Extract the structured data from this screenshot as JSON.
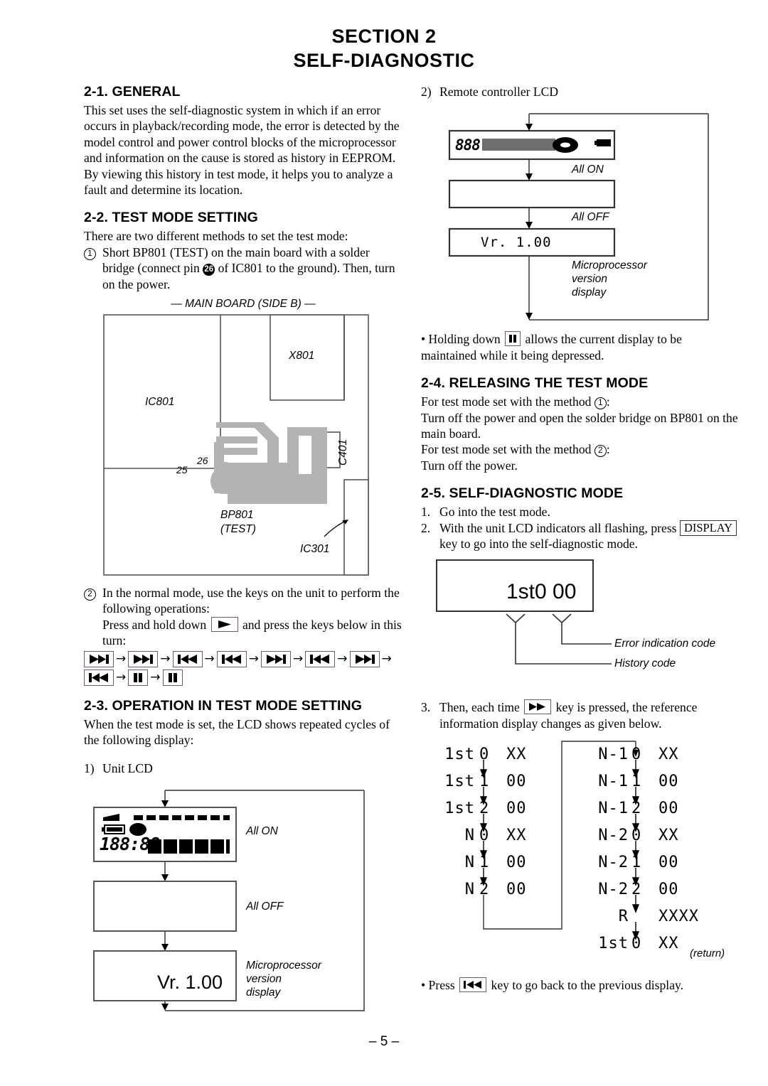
{
  "title": {
    "line1": "SECTION 2",
    "line2": "SELF-DIAGNOSTIC"
  },
  "page_number": "– 5 –",
  "sections": {
    "general": {
      "heading": "2-1. GENERAL",
      "paragraph1": "This set uses the self-diagnostic system in which if an error occurs in playback/recording mode, the error is detected by the model control and power control blocks of the microprocessor and information on the cause is stored as history in EEPROM.",
      "paragraph2": "By viewing this history in test mode, it helps you to analyze a fault and determine its location."
    },
    "test_mode_setting": {
      "heading": "2-2. TEST MODE SETTING",
      "intro": "There are two different methods to set the test mode:",
      "method1_num": "1",
      "method1_a": "Short BP801 (TEST) on the main board with a solder bridge (connect pin",
      "method1_pin": "26",
      "method1_b": "of IC801 to the ground).  Then, turn on the power.",
      "method2_num": "2",
      "method2_a": "In the normal mode, use the keys on the unit to perform the following operations:",
      "method2_b_pre": "Press and hold down",
      "method2_b_post": "and press the keys below in this turn:",
      "key_sequence": [
        "ffwd",
        "ffwd",
        "rew",
        "rew",
        "ffwd",
        "rew",
        "ffwd",
        "rew",
        "pause",
        "pause"
      ]
    },
    "board_figure": {
      "caption": "— MAIN BOARD (SIDE B) —",
      "labels": {
        "ic801": "IC801",
        "x801": "X801",
        "c401": "C401",
        "bp801_line1": "BP801",
        "bp801_line2": "(TEST)",
        "ic301": "IC301",
        "pin25": "25",
        "pin26": "26"
      }
    },
    "operation_in_test_mode": {
      "heading": "2-3. OPERATION IN TEST MODE SETTING",
      "paragraph": "When the test mode is set, the LCD shows repeated cycles of the following display:",
      "sub1_num": "1)",
      "sub1_label": "Unit LCD",
      "sub2_num": "2)",
      "sub2_label": "Remote controller LCD"
    },
    "unit_lcd_flow": {
      "step1_note": "All ON",
      "step2_note": "All OFF",
      "step3_note": "Microprocessor\nversion\ndisplay",
      "step3_value": "Vr. 1.00",
      "segment_digits": "188:88"
    },
    "remote_lcd_flow": {
      "step1_note": "All ON",
      "step2_note": "All OFF",
      "step3_note": "Microprocessor\nversion\ndisplay",
      "step3_value": "Vr. 1.00",
      "segment_digits": "888"
    },
    "hold_note": {
      "pre": "• Holding down",
      "post": "allows the current display to be maintained while it being depressed."
    },
    "releasing_test_mode": {
      "heading": "2-4. RELEASING THE TEST MODE",
      "line1_pre": "For test mode set with the method",
      "line1_num": "1",
      "line1_post": ":",
      "line2": "Turn off the power and open the solder bridge on BP801 on the main board.",
      "line3_pre": "For test mode set with the method",
      "line3_num": "2",
      "line3_post": ":",
      "line4": "Turn off the power."
    },
    "self_diagnostic_mode": {
      "heading": "2-5. SELF-DIAGNOSTIC MODE",
      "step1_num": "1.",
      "step1": "Go into the test mode.",
      "step2_num": "2.",
      "step2_a": "With the unit LCD indicators all flashing, press",
      "step2_key": "DISPLAY",
      "step2_b": "key to go into the self-diagnostic mode.",
      "display_value": "1st0  00",
      "callout_error": "Error indication code",
      "callout_history": "History code",
      "step3_num": "3.",
      "step3_a": "Then, each time",
      "step3_b": "key is pressed, the reference information display changes as given below.",
      "press_back_pre": "• Press",
      "press_back_post": "key to go back to the previous display."
    }
  },
  "code_table": {
    "left_column": [
      {
        "history": "1st",
        "index": "0",
        "error": "XX"
      },
      {
        "history": "1st",
        "index": "1",
        "error": "00"
      },
      {
        "history": "1st",
        "index": "2",
        "error": "00"
      },
      {
        "history": "N",
        "index": "0",
        "error": "XX"
      },
      {
        "history": "N",
        "index": "1",
        "error": "00"
      },
      {
        "history": "N",
        "index": "2",
        "error": "00"
      }
    ],
    "right_column": [
      {
        "history": "N‑1",
        "index": "0",
        "error": "XX"
      },
      {
        "history": "N‑1",
        "index": "1",
        "error": "00"
      },
      {
        "history": "N‑1",
        "index": "2",
        "error": "00"
      },
      {
        "history": "N‑2",
        "index": "0",
        "error": "XX"
      },
      {
        "history": "N‑2",
        "index": "1",
        "error": "00"
      },
      {
        "history": "N‑2",
        "index": "2",
        "error": "00"
      },
      {
        "history": "R",
        "index": "",
        "error": "XXXX"
      },
      {
        "history": "1st",
        "index": "0",
        "error": "XX"
      }
    ],
    "return_label": "(return)"
  }
}
